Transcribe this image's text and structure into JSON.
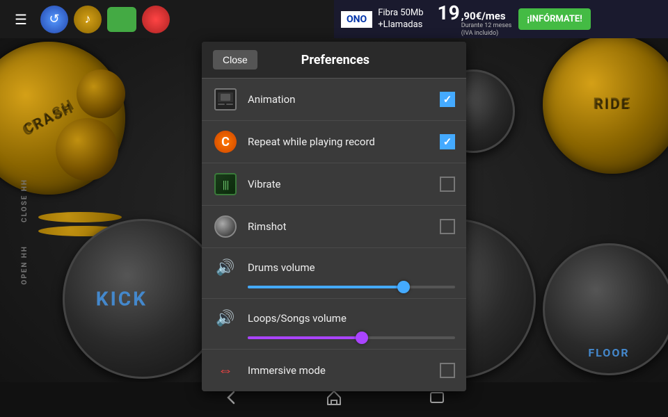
{
  "toolbar": {
    "menu_icon": "☰",
    "buttons": [
      "menu",
      "refresh",
      "music-note",
      "green-square",
      "red-circle"
    ]
  },
  "ad": {
    "brand": "ONO",
    "line1": "Fibra 50Mb",
    "line2": "+Llamadas",
    "price": "19",
    "price_decimal": ",90€/mes",
    "price_detail1": "Durante 12 meses",
    "price_detail2": "(IVA incluido)",
    "cta": "¡INFÓRMATE!"
  },
  "modal": {
    "close_label": "Close",
    "title": "Preferences",
    "items": [
      {
        "id": "animation",
        "label": "Animation",
        "icon_type": "animation",
        "checked": true
      },
      {
        "id": "repeat",
        "label": "Repeat while playing record",
        "icon_type": "repeat",
        "checked": true
      },
      {
        "id": "vibrate",
        "label": "Vibrate",
        "icon_type": "vibrate",
        "checked": false
      },
      {
        "id": "rimshot",
        "label": "Rimshot",
        "icon_type": "rimshot",
        "checked": false
      }
    ],
    "sliders": [
      {
        "id": "drums-volume",
        "label": "Drums volume",
        "icon_color": "blue",
        "value": 85,
        "fill_width": "75%",
        "thumb_left": "75%"
      },
      {
        "id": "loops-volume",
        "label": "Loops/Songs volume",
        "icon_color": "purple",
        "value": 60,
        "fill_width": "55%",
        "thumb_left": "55%"
      }
    ],
    "immersive": {
      "label": "Immersive mode",
      "checked": false
    }
  },
  "nav": {
    "back_icon": "←",
    "home_icon": "⌂",
    "recents_icon": "▭"
  },
  "background": {
    "labels": [
      "CRASH",
      "RIDE",
      "CLOSE HH",
      "OPEN HH",
      "KICK",
      "KICK",
      "FLOOR"
    ]
  }
}
